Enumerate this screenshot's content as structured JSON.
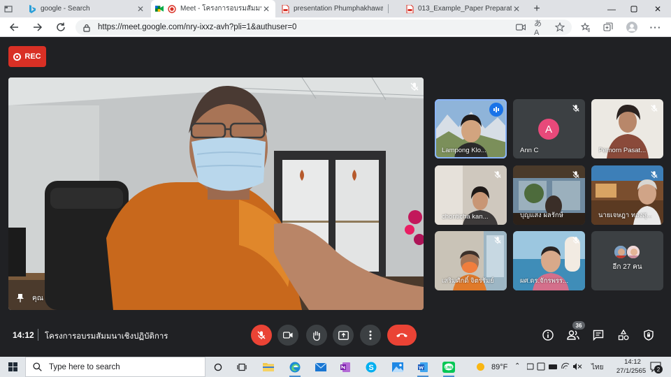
{
  "browser": {
    "tabs": [
      {
        "label": "google - Search",
        "icon": "bing-icon",
        "active": false
      },
      {
        "label": "Meet - โครงการอบรมสัมมนาเชิ",
        "icon": "meet-icon",
        "active": true
      },
      {
        "label": "presentation Phumphakhawat",
        "icon": "pdf-icon",
        "active": false
      },
      {
        "label": "013_Example_Paper Preparation",
        "icon": "pdf-icon",
        "active": false
      }
    ],
    "new_tab_label": "+",
    "url": "https://meet.google.com/nry-ixxz-avh?pli=1&authuser=0",
    "translate_label": "あA"
  },
  "meet": {
    "rec_label": "REC",
    "main_video": {
      "name": "คุณ"
    },
    "participants": [
      {
        "name": "Lampong Klo...",
        "speaking": true,
        "muted": false,
        "avatar_letter": ""
      },
      {
        "name": "Ann C",
        "speaking": false,
        "muted": true,
        "avatar_letter": "A"
      },
      {
        "name": "Pemorn Pasat...",
        "speaking": false,
        "muted": true,
        "avatar_letter": ""
      },
      {
        "name": "chonticha kan...",
        "speaking": false,
        "muted": true,
        "avatar_letter": ""
      },
      {
        "name": "บุญแสง ผลรักษ์",
        "speaking": false,
        "muted": true,
        "avatar_letter": ""
      },
      {
        "name": "นายเจษฎา ทองสุ...",
        "speaking": false,
        "muted": true,
        "avatar_letter": ""
      },
      {
        "name": "เสริมศักดิ์ จิตรรัมย์",
        "speaking": false,
        "muted": true,
        "avatar_letter": ""
      },
      {
        "name": "ผศ.ดร.จักรพรร...",
        "speaking": false,
        "muted": true,
        "avatar_letter": ""
      }
    ],
    "more_participants_label": "อีก 27 คน",
    "time": "14:12",
    "meeting_title": "โครงการอบรมสัมมนาเชิงปฏิบัติการ",
    "people_count": "36",
    "colors": {
      "accent_red": "#ea4335",
      "speaking_outline": "#8ab4f8",
      "avatar_pink": "#e8497a"
    }
  },
  "taskbar": {
    "search_placeholder": "Type here to search",
    "weather": "89°F",
    "language": "ไทย",
    "clock_time": "14:12",
    "clock_date": "27/1/2565",
    "notification_count": "2"
  }
}
